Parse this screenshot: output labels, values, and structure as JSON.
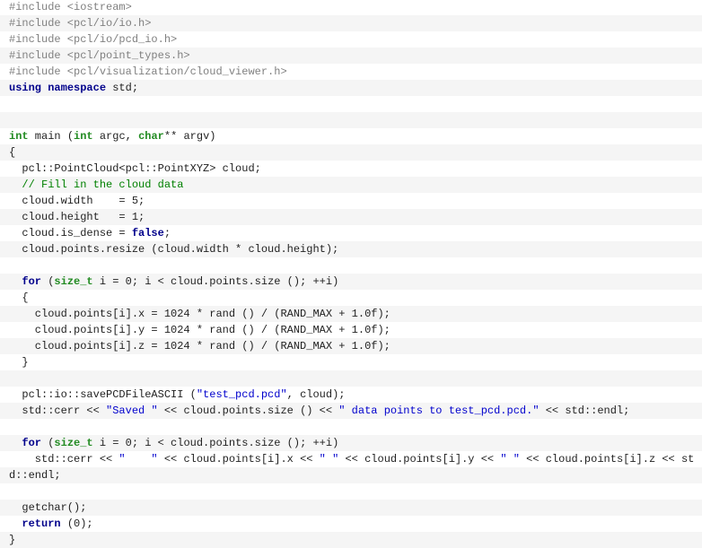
{
  "editor": {
    "language": "cpp",
    "colors": {
      "background": "#ffffff",
      "alt_row": "#f5f5f5",
      "preprocessor": "#808080",
      "keyword": "#00008b",
      "type": "#228b22",
      "string": "#0000cd",
      "comment": "#008000",
      "text": "#1f1f1f"
    },
    "lines": [
      [
        {
          "t": "#include <iostream>",
          "c": "pre"
        }
      ],
      [
        {
          "t": "#include <pcl/io/io.h>",
          "c": "pre"
        }
      ],
      [
        {
          "t": "#include <pcl/io/pcd_io.h>",
          "c": "pre"
        }
      ],
      [
        {
          "t": "#include <pcl/point_types.h>",
          "c": "pre"
        }
      ],
      [
        {
          "t": "#include <pcl/visualization/cloud_viewer.h>",
          "c": "pre"
        }
      ],
      [
        {
          "t": "using",
          "c": "kw"
        },
        {
          "t": " ",
          "c": "plain"
        },
        {
          "t": "namespace",
          "c": "kw"
        },
        {
          "t": " std;",
          "c": "plain"
        }
      ],
      [],
      [],
      [
        {
          "t": "int",
          "c": "type"
        },
        {
          "t": " main (",
          "c": "plain"
        },
        {
          "t": "int",
          "c": "type"
        },
        {
          "t": " argc, ",
          "c": "plain"
        },
        {
          "t": "char",
          "c": "type"
        },
        {
          "t": "** argv)",
          "c": "plain"
        }
      ],
      [
        {
          "t": "{",
          "c": "plain"
        }
      ],
      [
        {
          "t": "  pcl::PointCloud<pcl::PointXYZ> cloud;",
          "c": "plain"
        }
      ],
      [
        {
          "t": "  ",
          "c": "plain"
        },
        {
          "t": "// Fill in the cloud data",
          "c": "com"
        }
      ],
      [
        {
          "t": "  cloud.width    = 5;",
          "c": "plain"
        }
      ],
      [
        {
          "t": "  cloud.height   = 1;",
          "c": "plain"
        }
      ],
      [
        {
          "t": "  cloud.is_dense = ",
          "c": "plain"
        },
        {
          "t": "false",
          "c": "kw"
        },
        {
          "t": ";",
          "c": "plain"
        }
      ],
      [
        {
          "t": "  cloud.points.resize (cloud.width * cloud.height);",
          "c": "plain"
        }
      ],
      [],
      [
        {
          "t": "  ",
          "c": "plain"
        },
        {
          "t": "for",
          "c": "kw"
        },
        {
          "t": " (",
          "c": "plain"
        },
        {
          "t": "size_t",
          "c": "type"
        },
        {
          "t": " i = 0; i < cloud.points.size (); ++i)",
          "c": "plain"
        }
      ],
      [
        {
          "t": "  {",
          "c": "plain"
        }
      ],
      [
        {
          "t": "    cloud.points[i].x = 1024 * rand () / (RAND_MAX + 1.0f);",
          "c": "plain"
        }
      ],
      [
        {
          "t": "    cloud.points[i].y = 1024 * rand () / (RAND_MAX + 1.0f);",
          "c": "plain"
        }
      ],
      [
        {
          "t": "    cloud.points[i].z = 1024 * rand () / (RAND_MAX + 1.0f);",
          "c": "plain"
        }
      ],
      [
        {
          "t": "  }",
          "c": "plain"
        }
      ],
      [],
      [
        {
          "t": "  pcl::io::savePCDFileASCII (",
          "c": "plain"
        },
        {
          "t": "\"test_pcd.pcd\"",
          "c": "str"
        },
        {
          "t": ", cloud);",
          "c": "plain"
        }
      ],
      [
        {
          "t": "  std::cerr << ",
          "c": "plain"
        },
        {
          "t": "\"Saved \"",
          "c": "str"
        },
        {
          "t": " << cloud.points.size () << ",
          "c": "plain"
        },
        {
          "t": "\" data points to test_pcd.pcd.\"",
          "c": "str"
        },
        {
          "t": " << std::endl;",
          "c": "plain"
        }
      ],
      [],
      [
        {
          "t": "  ",
          "c": "plain"
        },
        {
          "t": "for",
          "c": "kw"
        },
        {
          "t": " (",
          "c": "plain"
        },
        {
          "t": "size_t",
          "c": "type"
        },
        {
          "t": " i = 0; i < cloud.points.size (); ++i)",
          "c": "plain"
        }
      ],
      [
        {
          "t": "    std::cerr << ",
          "c": "plain"
        },
        {
          "t": "\"    \"",
          "c": "str"
        },
        {
          "t": " << cloud.points[i].x << ",
          "c": "plain"
        },
        {
          "t": "\" \"",
          "c": "str"
        },
        {
          "t": " << cloud.points[i].y << ",
          "c": "plain"
        },
        {
          "t": "\" \"",
          "c": "str"
        },
        {
          "t": " << cloud.points[i].z << st",
          "c": "plain"
        }
      ],
      [
        {
          "t": "d::endl;",
          "c": "plain"
        }
      ],
      [],
      [
        {
          "t": "  getchar();",
          "c": "plain"
        }
      ],
      [
        {
          "t": "  ",
          "c": "plain"
        },
        {
          "t": "return",
          "c": "kw"
        },
        {
          "t": " (0);",
          "c": "plain"
        }
      ],
      [
        {
          "t": "}",
          "c": "plain"
        }
      ]
    ]
  }
}
